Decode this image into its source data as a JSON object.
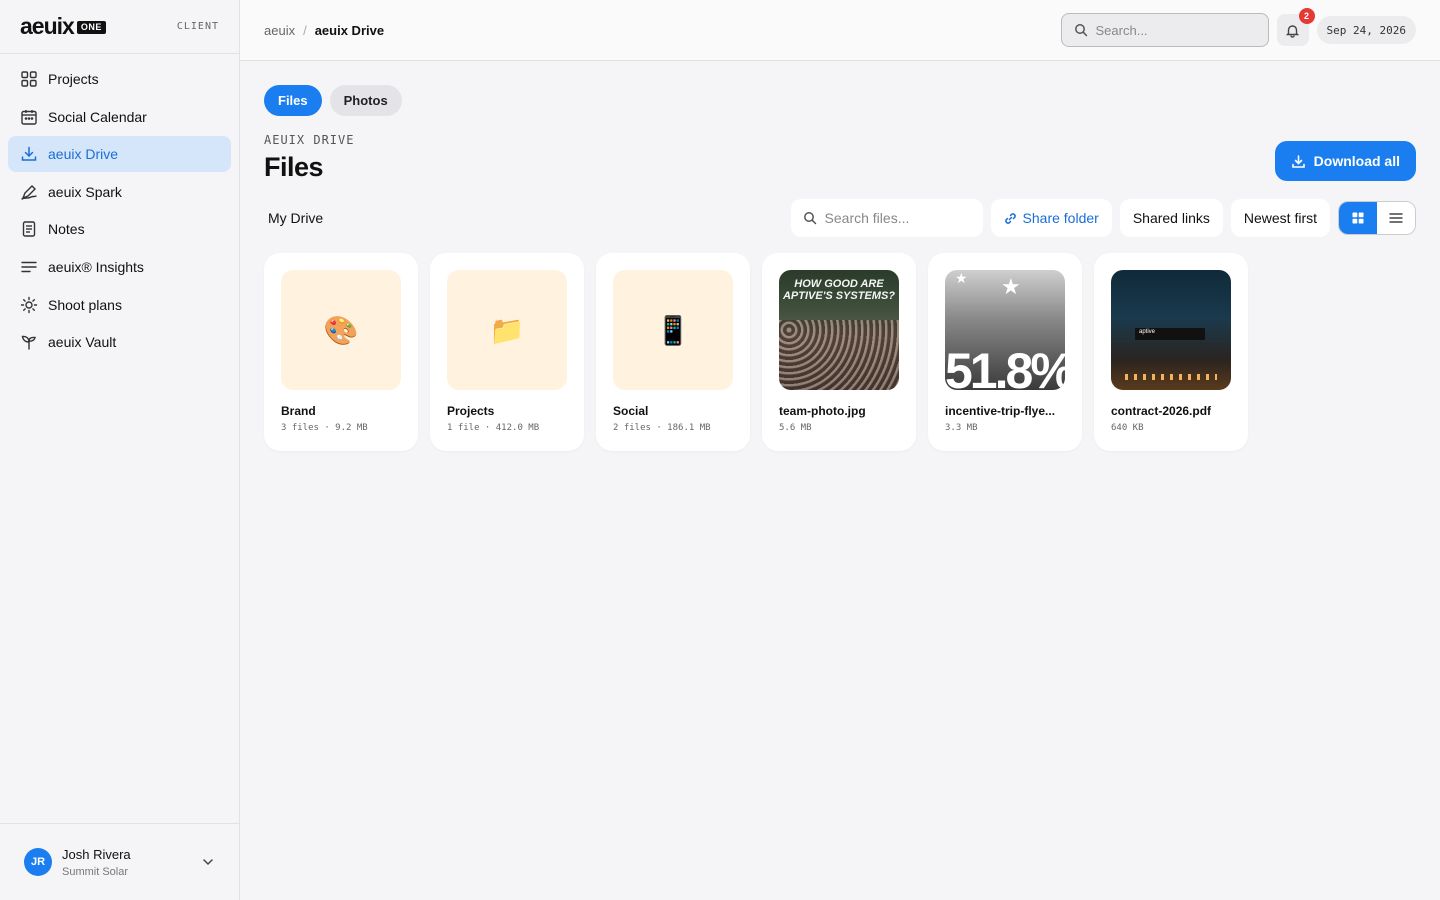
{
  "brand": {
    "logo_word": "aeuix",
    "logo_badge": "ONE",
    "tag": "CLIENT"
  },
  "sidebar": {
    "items": [
      {
        "label": "Projects",
        "icon": "grid-icon",
        "active": false
      },
      {
        "label": "Social Calendar",
        "icon": "calendar-icon",
        "active": false
      },
      {
        "label": "aeuix Drive",
        "icon": "download-icon",
        "active": true
      },
      {
        "label": "aeuix Spark",
        "icon": "pen-icon",
        "active": false
      },
      {
        "label": "Notes",
        "icon": "document-icon",
        "active": false
      },
      {
        "label": "aeuix® Insights",
        "icon": "lines-icon",
        "active": false
      },
      {
        "label": "Shoot plans",
        "icon": "sun-icon",
        "active": false
      },
      {
        "label": "aeuix Vault",
        "icon": "sprout-icon",
        "active": false
      }
    ]
  },
  "user": {
    "initials": "JR",
    "name": "Josh Rivera",
    "org": "Summit Solar"
  },
  "topbar": {
    "breadcrumb_root": "aeuix",
    "breadcrumb_sep": "/",
    "breadcrumb_current": "aeuix Drive",
    "search_placeholder": "Search...",
    "notification_count": "2",
    "date": "Sep 24, 2026"
  },
  "tabs": [
    {
      "label": "Files",
      "active": true
    },
    {
      "label": "Photos",
      "active": false
    }
  ],
  "header": {
    "eyebrow": "AEUIX DRIVE",
    "title": "Files",
    "download_label": "Download all"
  },
  "toolbar": {
    "drive_label": "My Drive",
    "search_placeholder": "Search files...",
    "share_label": "Share folder",
    "shared_links_label": "Shared links",
    "sort_label": "Newest first"
  },
  "files": [
    {
      "name": "Brand",
      "meta": "3 files · 9.2 MB",
      "kind": "folder",
      "emoji": "🎨"
    },
    {
      "name": "Projects",
      "meta": "1 file · 412.0 MB",
      "kind": "folder",
      "emoji": "📁"
    },
    {
      "name": "Social",
      "meta": "2 files · 186.1 MB",
      "kind": "folder",
      "emoji": "📱"
    },
    {
      "name": "team-photo.jpg",
      "meta": "5.6 MB",
      "kind": "image",
      "headline": "HOW GOOD ARE APTIVE'S SYSTEMS?"
    },
    {
      "name": "incentive-trip-flye...",
      "meta": "3.3 MB",
      "kind": "image",
      "headline": "51.8%"
    },
    {
      "name": "contract-2026.pdf",
      "meta": "640 KB",
      "kind": "image",
      "headline": "aptive"
    }
  ],
  "colors": {
    "accent": "#1a7ef0",
    "active_nav_bg": "#d6e6fa",
    "folder_thumb": "#fff2df",
    "badge": "#e53935"
  }
}
